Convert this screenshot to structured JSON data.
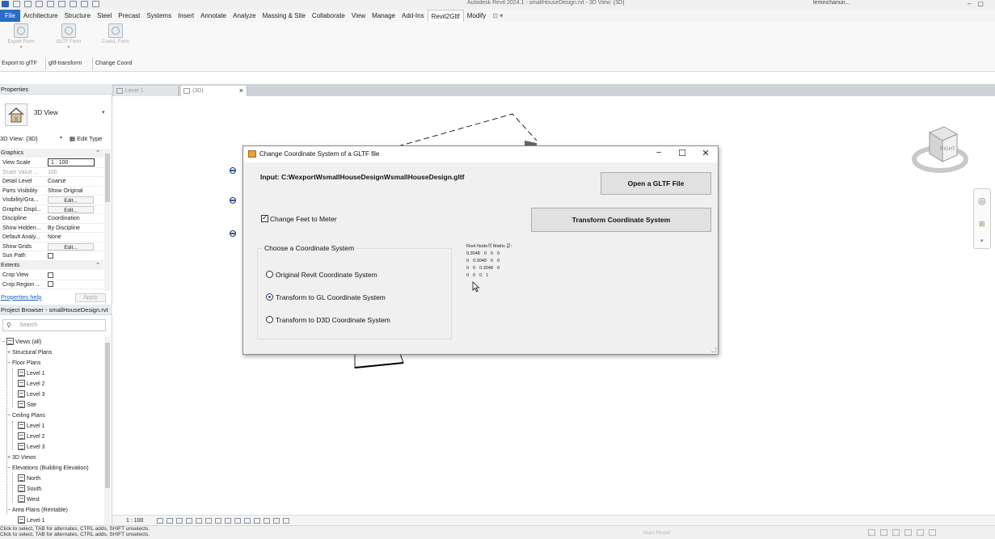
{
  "window": {
    "title": "Autodesk Revit 2024.1 - smallHouseDesign.rvt - 3D View: {3D}",
    "user": "leminchanun..."
  },
  "ribbon": {
    "tabs": [
      "File",
      "Architecture",
      "Structure",
      "Steel",
      "Precast",
      "Systems",
      "Insert",
      "Annotate",
      "Analyze",
      "Massing & Site",
      "Collaborate",
      "View",
      "Manage",
      "Add-Ins",
      "Revit2Gltf",
      "Modify"
    ],
    "active_tab": "Revit2Gltf",
    "buttons": [
      {
        "label": "Export Form",
        "panel": "Export to glTF"
      },
      {
        "label": "GLTF Form",
        "panel": "gltf-transform"
      },
      {
        "label": "Coord. Form",
        "panel": "Change Coord"
      }
    ]
  },
  "properties": {
    "header": "Properties",
    "type_name": "3D View",
    "view_selector": "3D View: {3D}",
    "edit_type": "Edit Type",
    "groups": {
      "graphics": "Graphics",
      "extents": "Extents"
    },
    "rows": [
      {
        "name": "View Scale",
        "value": "1 : 100"
      },
      {
        "name": "Scale Value ...",
        "value": "100"
      },
      {
        "name": "Detail Level",
        "value": "Coarse"
      },
      {
        "name": "Parts Visibility",
        "value": "Show Original"
      },
      {
        "name": "Visibility/Gra...",
        "value": "Edit..."
      },
      {
        "name": "Graphic Displ...",
        "value": "Edit..."
      },
      {
        "name": "Discipline",
        "value": "Coordination"
      },
      {
        "name": "Show Hidden...",
        "value": "By Discipline"
      },
      {
        "name": "Default Analy...",
        "value": "None"
      },
      {
        "name": "Show Grids",
        "value": "Edit..."
      },
      {
        "name": "Sun Path",
        "value": ""
      }
    ],
    "extent_rows": [
      {
        "name": "Crop View",
        "value": ""
      },
      {
        "name": "Crop Region ...",
        "value": ""
      }
    ],
    "help_link": "Properties help",
    "apply": "Apply"
  },
  "project_browser": {
    "header": "Project Browser - smallHouseDesign.rvt",
    "search_placeholder": "Search",
    "nodes": {
      "views_all": "Views (all)",
      "structural_plans": "Structural Plans",
      "floor_plans": "Floor Plans",
      "fp_level1": "Level 1",
      "fp_level2": "Level 2",
      "fp_level3": "Level 3",
      "fp_site": "Site",
      "ceiling_plans": "Ceiling Plans",
      "cp_level1": "Level 1",
      "cp_level2": "Level 2",
      "cp_level3": "Level 3",
      "views_3d": "3D Views",
      "elevations": "Elevations (Building Elevation)",
      "el_north": "North",
      "el_south": "South",
      "el_west": "West",
      "area_plans": "Area Plans (Rentable)",
      "ap_level1": "Level 1"
    }
  },
  "view_tabs": [
    {
      "label": "Level 1",
      "closable": false
    },
    {
      "label": "{3D}",
      "closable": true
    }
  ],
  "viewcube": {
    "face": "RIGHT"
  },
  "view_control": {
    "scale": "1 : 100"
  },
  "status": {
    "line1": "Click to select, TAB for alternates, CTRL adds, SHIFT unselects.",
    "line2": "Click to select, TAB for alternates, CTRL adds, SHIFT unselects.",
    "model": "Main Model"
  },
  "dialog": {
    "title": "Change Coordinate System of a GLTF file",
    "input_label": "Input: C:WexportWsmallHouseDesignWsmallHouseDesign.gltf",
    "open_button": "Open a GLTF File",
    "transform_button": "Transform Coordinate System",
    "checkbox_label": "Change Feet to Meter",
    "checkbox_checked": true,
    "group_title": "Choose a Coordinate System",
    "options": [
      {
        "label": "Original Revit Coordinate System",
        "selected": false
      },
      {
        "label": "Transform to GL Coordinate System",
        "selected": true
      },
      {
        "label": "Transform to D3D Coordinate System",
        "selected": false
      }
    ],
    "matrix_header": "Root Node의 Matrix 값:",
    "matrix_rows": [
      [
        "0.3048",
        "0",
        "0",
        "0"
      ],
      [
        "0",
        "0.3048",
        "0",
        "0"
      ],
      [
        "0",
        "0",
        "0.3048",
        "0"
      ],
      [
        "0",
        "0",
        "0",
        "1"
      ]
    ]
  },
  "colors": {
    "file_tab": "#2b6cc4",
    "link": "#1d5fc0",
    "radio_dot": "#1a5ccc"
  }
}
